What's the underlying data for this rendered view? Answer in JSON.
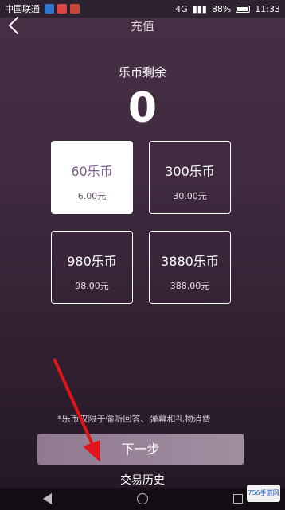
{
  "status_bar": {
    "carrier": "中国联通",
    "network": "4G",
    "battery": "88%",
    "time": "11:33"
  },
  "header": {
    "title": "充值"
  },
  "balance": {
    "label": "乐币剩余",
    "value": "0"
  },
  "options": [
    {
      "name": "60乐币",
      "price": "6.00元",
      "selected": true
    },
    {
      "name": "300乐币",
      "price": "30.00元",
      "selected": false
    },
    {
      "name": "980乐币",
      "price": "98.00元",
      "selected": false
    },
    {
      "name": "3880乐币",
      "price": "388.00元",
      "selected": false
    }
  ],
  "note": "*乐币仅限于偷听回答、弹幕和礼物消费",
  "next_button": "下一步",
  "history_link": "交易历史",
  "watermark": "756手游网",
  "colors": {
    "accent": "#7b5f88",
    "button": "#a28ea1",
    "arrow": "#e0151b"
  }
}
